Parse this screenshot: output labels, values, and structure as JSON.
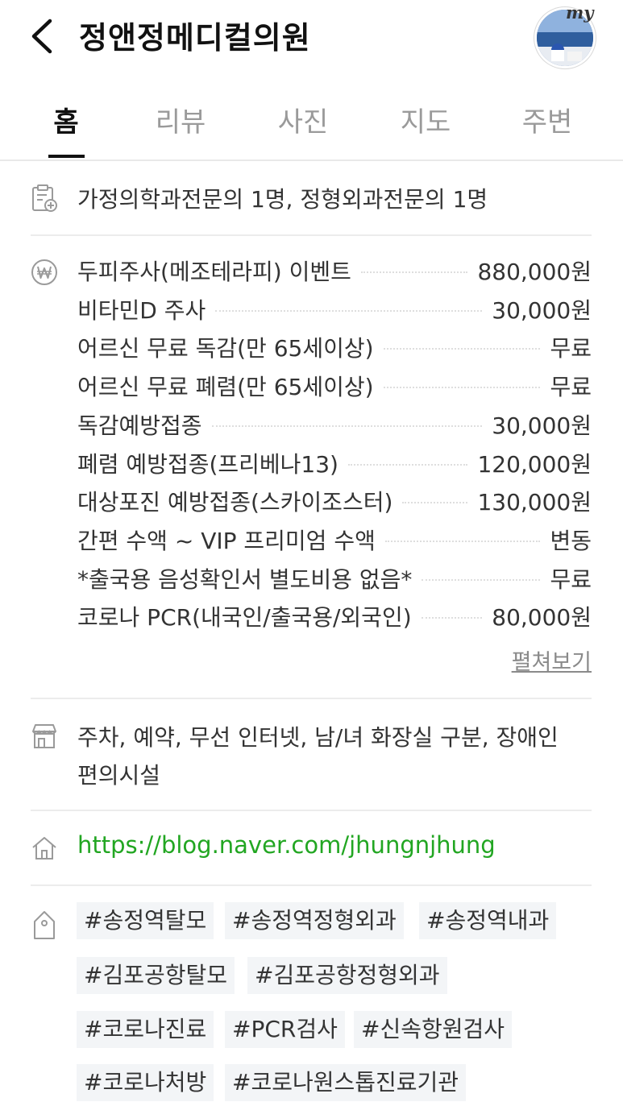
{
  "header": {
    "title": "정앤정메디컬의원",
    "my_badge": "my"
  },
  "tabs": [
    {
      "label": "홈",
      "active": true
    },
    {
      "label": "리뷰",
      "active": false
    },
    {
      "label": "사진",
      "active": false
    },
    {
      "label": "지도",
      "active": false
    },
    {
      "label": "주변",
      "active": false
    }
  ],
  "doctors": {
    "icon": "clipboard-medical-icon",
    "text": "가정의학과전문의 1명, 정형외과전문의 1명"
  },
  "prices": {
    "icon": "won-currency-icon",
    "items": [
      {
        "name": "두피주사(메조테라피) 이벤트",
        "value": "880,000원"
      },
      {
        "name": "비타민D 주사",
        "value": "30,000원"
      },
      {
        "name": "어르신 무료 독감(만 65세이상)",
        "value": "무료"
      },
      {
        "name": "어르신 무료 폐렴(만 65세이상)",
        "value": "무료"
      },
      {
        "name": "독감예방접종",
        "value": "30,000원"
      },
      {
        "name": "폐렴 예방접종(프리베나13)",
        "value": "120,000원"
      },
      {
        "name": "대상포진 예방접종(스카이조스터)",
        "value": "130,000원"
      },
      {
        "name": "간편 수액 ~ VIP 프리미엄 수액",
        "value": "변동"
      },
      {
        "name": "*출국용 음성확인서 별도비용 없음*",
        "value": "무료"
      },
      {
        "name": "코로나 PCR(내국인/출국용/외국인)",
        "value": "80,000원"
      }
    ],
    "more_label": "펼쳐보기"
  },
  "facilities": {
    "icon": "store-icon",
    "line1": "주차, 예약, 무선 인터넷, 남/녀 화장실 구분, 장애인",
    "line2": "편의시설"
  },
  "homepage": {
    "icon": "home-icon",
    "url": "https://blog.naver.com/jhungnjhung"
  },
  "tags": {
    "icon": "tag-icon",
    "items": [
      "#송정역탈모",
      "#송정역정형외과",
      "#송정역내과",
      "#김포공항탈모",
      "#김포공항정형외과",
      "#코로나진료",
      "#PCR검사",
      "#신속항원검사",
      "#코로나처방",
      "#코로나원스톱진료기관"
    ]
  },
  "colors": {
    "link_green": "#22a622",
    "tag_bg": "#f3f5f7",
    "active_tab": "#111111",
    "inactive_tab": "#9a9a9a"
  }
}
